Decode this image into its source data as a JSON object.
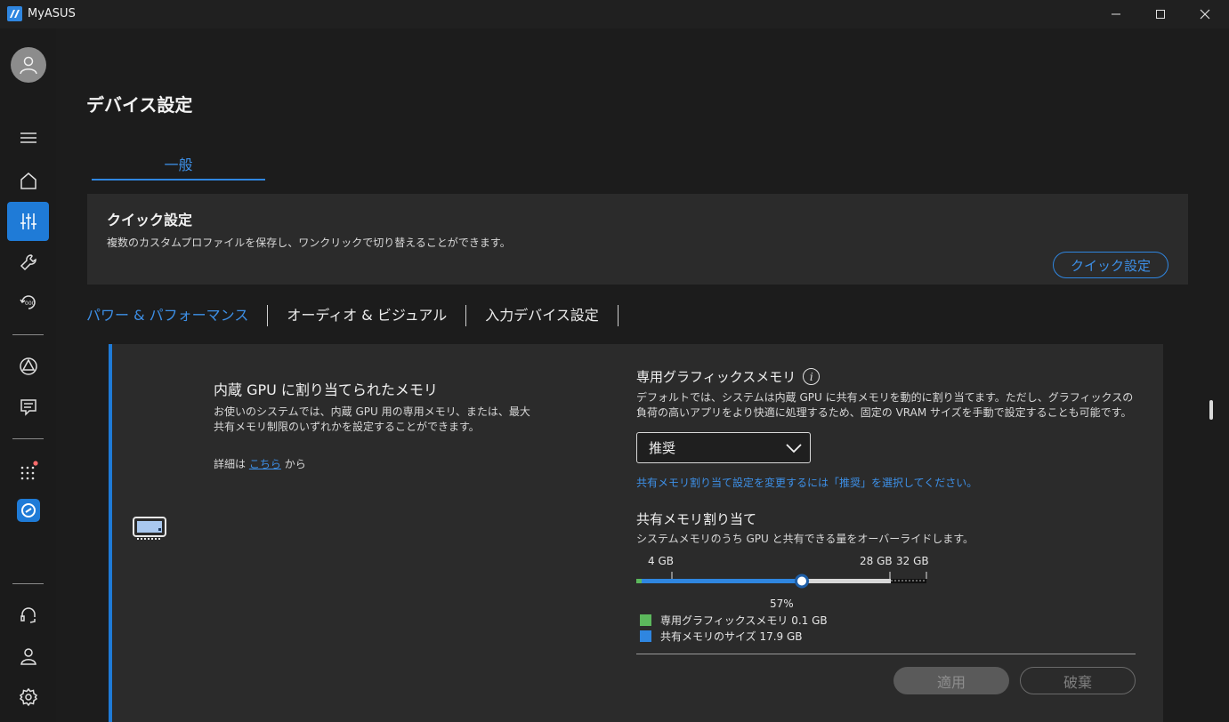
{
  "window": {
    "title": "MyASUS",
    "minimize_icon": "minimize-icon",
    "maximize_icon": "maximize-icon",
    "close_icon": "close-icon"
  },
  "sidebar": {
    "items": [
      "avatar-icon",
      "menu-icon",
      "home-icon",
      "sliders-icon",
      "wrench-icon",
      "recovery-icon",
      "triangle-logo-icon",
      "chat-icon",
      "apps-icon",
      "link-app-icon",
      "headset-icon",
      "user-icon",
      "gear-icon"
    ],
    "active": "sliders-icon"
  },
  "page": {
    "title": "デバイス設定",
    "tab": "一般"
  },
  "quick": {
    "title": "クイック設定",
    "desc": "複数のカスタムプロファイルを保存し、ワンクリックで切り替えることができます。",
    "button": "クイック設定"
  },
  "subtabs": [
    "パワー & パフォーマンス",
    "オーディオ & ビジュアル",
    "入力デバイス設定"
  ],
  "gpu": {
    "title": "内蔵 GPU に割り当てられたメモリ",
    "desc": "お使いのシステムでは、内蔵 GPU 用の専用メモリ、または、最大共有メモリ制限のいずれかを設定することができます。",
    "learn_prefix": "詳細は",
    "learn_link": "こちら",
    "learn_suffix": "から"
  },
  "dedicated": {
    "title": "専用グラフィックスメモリ",
    "desc": "デフォルトでは、システムは内蔵 GPU に共有メモリを動的に割り当てます。ただし、グラフィックスの負荷の高いアプリをより快適に処理するため、固定の VRAM サイズを手動で設定することも可能です。",
    "select_value": "推奨",
    "hint": "共有メモリ割り当て設定を変更するには「推奨」を選択してください。"
  },
  "shared": {
    "title": "共有メモリ割り当て",
    "desc": "システムメモリのうち GPU と共有できる量をオーバーライドします。",
    "ticks": [
      "4 GB",
      "28 GB",
      "32 GB"
    ],
    "percent_label": "57%",
    "percent": 0.57,
    "legend": [
      {
        "label": "専用グラフィックスメモリ  0.1 GB",
        "color": "#5cb85c"
      },
      {
        "label": "共有メモリのサイズ  17.9 GB",
        "color": "#2f86e0"
      }
    ]
  },
  "actions": {
    "apply": "適用",
    "discard": "破棄"
  },
  "colors": {
    "accent": "#2f86e0",
    "bg": "#1c1c1c",
    "card": "#2b2b2b"
  }
}
